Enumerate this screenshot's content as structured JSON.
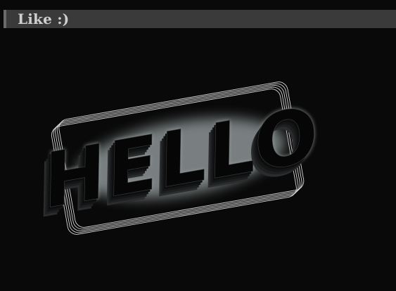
{
  "header": {
    "title": "Like :)"
  },
  "sign": {
    "text": "HELLO"
  },
  "colors": {
    "background": "#090909",
    "header_bar": "#3a3a3a",
    "header_accent": "#6a6a6a",
    "header_text": "#cfcfcf",
    "sign_outline": "#d8d8d8",
    "glow": "#8f9697",
    "letters": "#060606"
  }
}
